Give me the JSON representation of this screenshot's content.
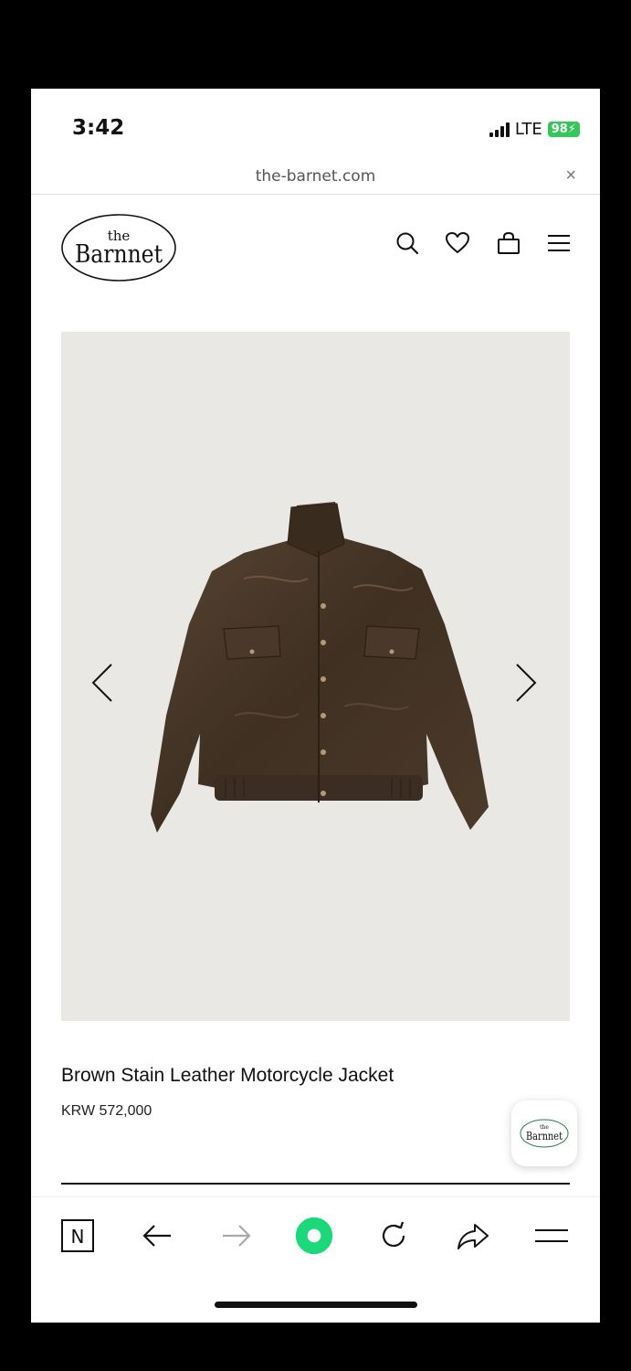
{
  "status_bar": {
    "time": "3:42",
    "network": "LTE",
    "battery": "98"
  },
  "browser": {
    "url": "the-barnet.com",
    "close_label": "×"
  },
  "site": {
    "logo_top": "the",
    "logo_main": "Barnnet",
    "icons": [
      "search-icon",
      "heart-icon",
      "bag-icon",
      "menu-icon"
    ]
  },
  "product": {
    "title": "Brown Stain Leather Motorcycle Jacket",
    "price": "KRW 572,000"
  },
  "fab": {
    "logo_top": "the",
    "logo_main": "Barnnet"
  },
  "toolbar": {
    "n_label": "N"
  },
  "colors": {
    "accent_green": "#1bd97a",
    "battery_green": "#34c759",
    "image_bg": "#e9e8e5"
  }
}
